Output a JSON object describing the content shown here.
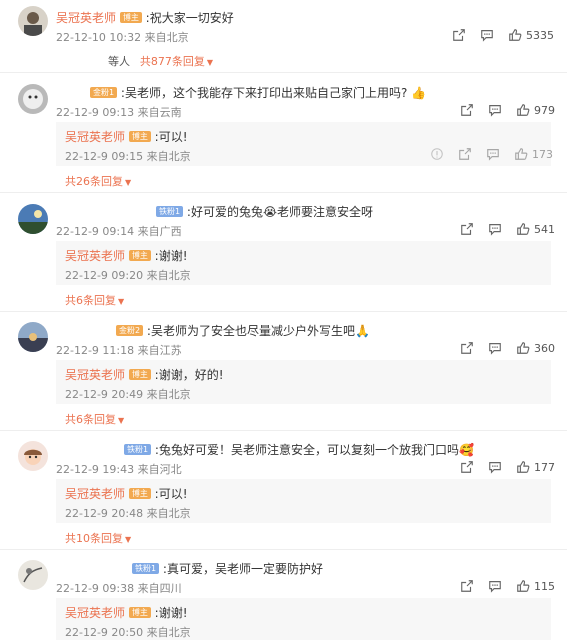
{
  "colors": {
    "name": "#eb7350",
    "meta": "#888888",
    "reply_bg": "#f7f7f7"
  },
  "comments": [
    {
      "avatar": "avatar-teacher",
      "user": "吴冠英老师",
      "badge": "博主",
      "text": ":祝大家一切安好",
      "meta": "22-12-10 10:32 来自北京",
      "likes": "5335",
      "footer_prefix": "等人",
      "footer_more": "共877条回复"
    },
    {
      "avatar": "avatar-white-pet",
      "badge": "金粉1",
      "text": ":吴老师，这个我能存下来打印出来贴自己家门上用吗?",
      "emoji": "👍",
      "meta": "22-12-9 09:13 来自云南",
      "likes": "979",
      "reply": {
        "user": "吴冠英老师",
        "badge": "博主",
        "text": ":可以!",
        "meta": "22-12-9 09:15 来自北京",
        "likes": "173"
      },
      "more": "共26条回复"
    },
    {
      "avatar": "avatar-landscape",
      "badge": "铁粉1",
      "text": ":好可爱的兔兔",
      "emoji": "😭",
      "text2": "老师要注意安全呀",
      "meta": "22-12-9 09:14 来自广西",
      "likes": "541",
      "reply": {
        "user": "吴冠英老师",
        "badge": "博主",
        "text": ":谢谢!",
        "meta": "22-12-9 09:20 来自北京"
      },
      "more": "共6条回复"
    },
    {
      "avatar": "avatar-sunset",
      "badge": "金粉2",
      "text": ":吴老师为了安全也尽量减少户外写生吧",
      "emoji": "🙏",
      "meta": "22-12-9 11:18 来自江苏",
      "likes": "360",
      "reply": {
        "user": "吴冠英老师",
        "badge": "博主",
        "text": ":谢谢，好的!",
        "meta": "22-12-9 20:49 来自北京"
      },
      "more": "共6条回复"
    },
    {
      "avatar": "avatar-cartoon-girl",
      "badge": "铁粉1",
      "text": ":兔兔好可爱！吴老师注意安全，可以复刻一个放我门口吗",
      "emoji": "🥰",
      "meta": "22-12-9 19:43 来自河北",
      "likes": "177",
      "reply": {
        "user": "吴冠英老师",
        "badge": "博主",
        "text": ":可以!",
        "meta": "22-12-9 20:48 来自北京"
      },
      "more": "共10条回复"
    },
    {
      "avatar": "avatar-sketch",
      "badge": "铁粉1",
      "text": ":真可爱，吴老师一定要防护好",
      "meta": "22-12-9 09:38 来自四川",
      "likes": "115",
      "reply": {
        "user": "吴冠英老师",
        "badge": "博主",
        "text": ":谢谢!",
        "meta": "22-12-9 20:50 来自北京"
      }
    }
  ]
}
